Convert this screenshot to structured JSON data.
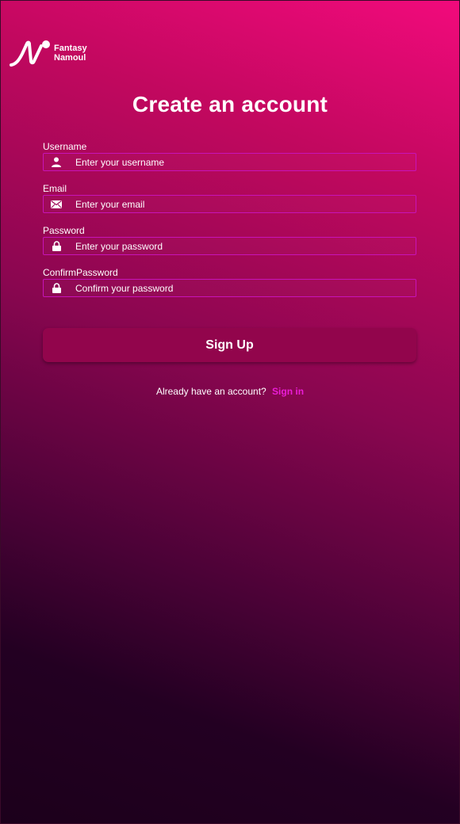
{
  "brand": {
    "line1": "Fantasy",
    "line2": "Namoul",
    "logo_icon": "n-logo-icon"
  },
  "page": {
    "title": "Create an account"
  },
  "form": {
    "fields": [
      {
        "label": "Username",
        "placeholder": "Enter your username",
        "value": "",
        "icon": "user-icon"
      },
      {
        "label": "Email",
        "placeholder": "Enter your email",
        "value": "",
        "icon": "envelope-icon"
      },
      {
        "label": "Password",
        "placeholder": "Enter your password",
        "value": "",
        "icon": "lock-icon"
      },
      {
        "label": "ConfirmPassword",
        "placeholder": "Confirm your password",
        "value": "",
        "icon": "lock-icon"
      }
    ],
    "submit_label": "Sign Up"
  },
  "footer": {
    "prompt": "Already have an account?",
    "link_label": "Sign in"
  },
  "colors": {
    "accent": "#e91dd6",
    "field_border": "#c713b8",
    "button_bg": "#92054c",
    "gradient_top": "#f20a7c",
    "gradient_bottom": "#1c001b"
  }
}
